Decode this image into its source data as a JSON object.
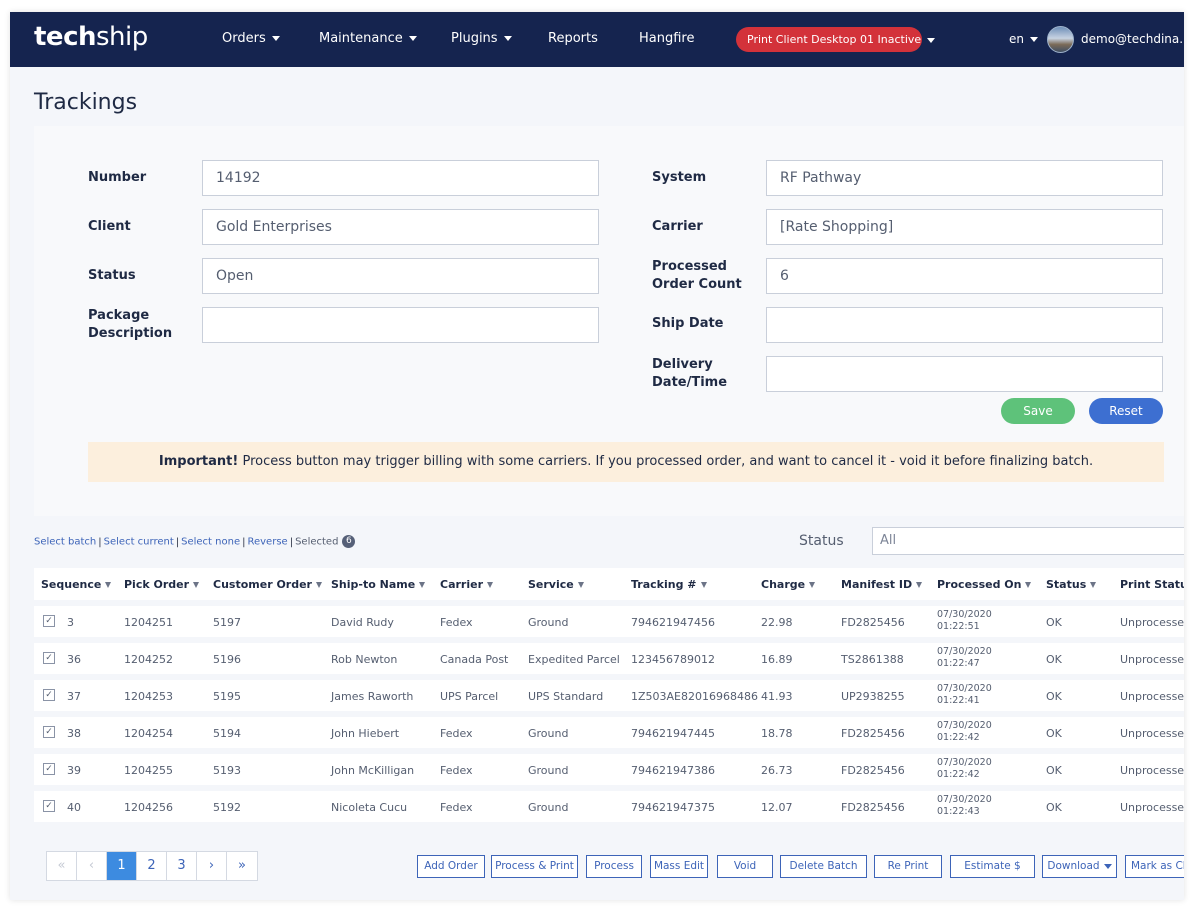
{
  "navbar": {
    "logo_bold": "tech",
    "logo_thin": "ship",
    "menu": [
      {
        "label": "Orders",
        "dropdown": true
      },
      {
        "label": "Maintenance",
        "dropdown": true
      },
      {
        "label": "Plugins",
        "dropdown": true
      },
      {
        "label": "Reports",
        "dropdown": false
      },
      {
        "label": "Hangfire",
        "dropdown": false
      }
    ],
    "print_badge": "Print Client Desktop 01 Inactive",
    "language": "en",
    "user": "demo@techdina..."
  },
  "page_title": "Trackings",
  "form": {
    "number": {
      "label": "Number",
      "value": "14192"
    },
    "client": {
      "label": "Client",
      "value": "Gold Enterprises"
    },
    "status": {
      "label": "Status",
      "value": "Open"
    },
    "package_description": {
      "label_line1": "Package",
      "label_line2": "Description",
      "value": ""
    },
    "system": {
      "label": "System",
      "value": "RF Pathway"
    },
    "carrier": {
      "label": "Carrier",
      "value": "[Rate Shopping]"
    },
    "processed_order_count": {
      "label_line1": "Processed",
      "label_line2": "Order Count",
      "value": "6"
    },
    "ship_date": {
      "label": "Ship Date",
      "value": ""
    },
    "delivery_datetime": {
      "label_line1": "Delivery",
      "label_line2": "Date/Time",
      "value": ""
    },
    "save_label": "Save",
    "reset_label": "Reset"
  },
  "notice": {
    "bold": "Important!",
    "text": " Process button may trigger billing with some carriers. If you processed order, and want to cancel it - void it before finalizing batch."
  },
  "selection": {
    "select_batch": "Select batch",
    "select_current": "Select current",
    "select_none": "Select none",
    "reverse": "Reverse",
    "selected_label": "Selected",
    "selected_count": "6"
  },
  "status_filter": {
    "label": "Status",
    "value": "All"
  },
  "table": {
    "columns": [
      "Sequence",
      "Pick Order",
      "Customer Order",
      "Ship-to Name",
      "Carrier",
      "Service",
      "Tracking #",
      "Charge",
      "Manifest ID",
      "Processed On",
      "Status",
      "Print Status"
    ],
    "rows": [
      {
        "sequence": "3",
        "pick_order": "1204251",
        "customer_order": "5197",
        "ship_to": "David Rudy",
        "carrier": "Fedex",
        "service": "Ground",
        "tracking": "794621947456",
        "charge": "22.98",
        "manifest": "FD2825456",
        "processed_date": "07/30/2020",
        "processed_time": "01:22:51",
        "status": "OK",
        "print_status": "Unprocessed"
      },
      {
        "sequence": "36",
        "pick_order": "1204252",
        "customer_order": "5196",
        "ship_to": "Rob Newton",
        "carrier": "Canada Post",
        "service": "Expedited Parcel",
        "tracking": "123456789012",
        "charge": "16.89",
        "manifest": "TS2861388",
        "processed_date": "07/30/2020",
        "processed_time": "01:22:47",
        "status": "OK",
        "print_status": "Unprocessed"
      },
      {
        "sequence": "37",
        "pick_order": "1204253",
        "customer_order": "5195",
        "ship_to": "James Raworth",
        "carrier": "UPS Parcel",
        "service": "UPS Standard",
        "tracking": "1Z503AE82016968486",
        "charge": "41.93",
        "manifest": "UP2938255",
        "processed_date": "07/30/2020",
        "processed_time": "01:22:41",
        "status": "OK",
        "print_status": "Unprocessed"
      },
      {
        "sequence": "38",
        "pick_order": "1204254",
        "customer_order": "5194",
        "ship_to": "John Hiebert",
        "carrier": "Fedex",
        "service": "Ground",
        "tracking": "794621947445",
        "charge": "18.78",
        "manifest": "FD2825456",
        "processed_date": "07/30/2020",
        "processed_time": "01:22:42",
        "status": "OK",
        "print_status": "Unprocessed"
      },
      {
        "sequence": "39",
        "pick_order": "1204255",
        "customer_order": "5193",
        "ship_to": "John McKilligan",
        "carrier": "Fedex",
        "service": "Ground",
        "tracking": "794621947386",
        "charge": "26.73",
        "manifest": "FD2825456",
        "processed_date": "07/30/2020",
        "processed_time": "01:22:42",
        "status": "OK",
        "print_status": "Unprocessed"
      },
      {
        "sequence": "40",
        "pick_order": "1204256",
        "customer_order": "5192",
        "ship_to": "Nicoleta Cucu",
        "carrier": "Fedex",
        "service": "Ground",
        "tracking": "794621947375",
        "charge": "12.07",
        "manifest": "FD2825456",
        "processed_date": "07/30/2020",
        "processed_time": "01:22:43",
        "status": "OK",
        "print_status": "Unprocessed"
      }
    ]
  },
  "pagination": {
    "first": "«",
    "prev": "‹",
    "pages": [
      "1",
      "2",
      "3"
    ],
    "current": "1",
    "next": "›",
    "last": "»"
  },
  "actions": {
    "add_order": "Add Order",
    "process_print": "Process & Print",
    "process": "Process",
    "mass_edit": "Mass Edit",
    "void": "Void",
    "delete_batch": "Delete Batch",
    "re_print": "Re Print",
    "estimate": "Estimate $",
    "download": "Download",
    "mark_as": "Mark as Cl"
  },
  "colors": {
    "navbar": "#15244f",
    "badge_red": "#d3323a",
    "save_green": "#5ec27a",
    "reset_blue": "#3d6fd1",
    "notice_bg": "#fcefdd",
    "link_blue": "#3d64b8"
  }
}
